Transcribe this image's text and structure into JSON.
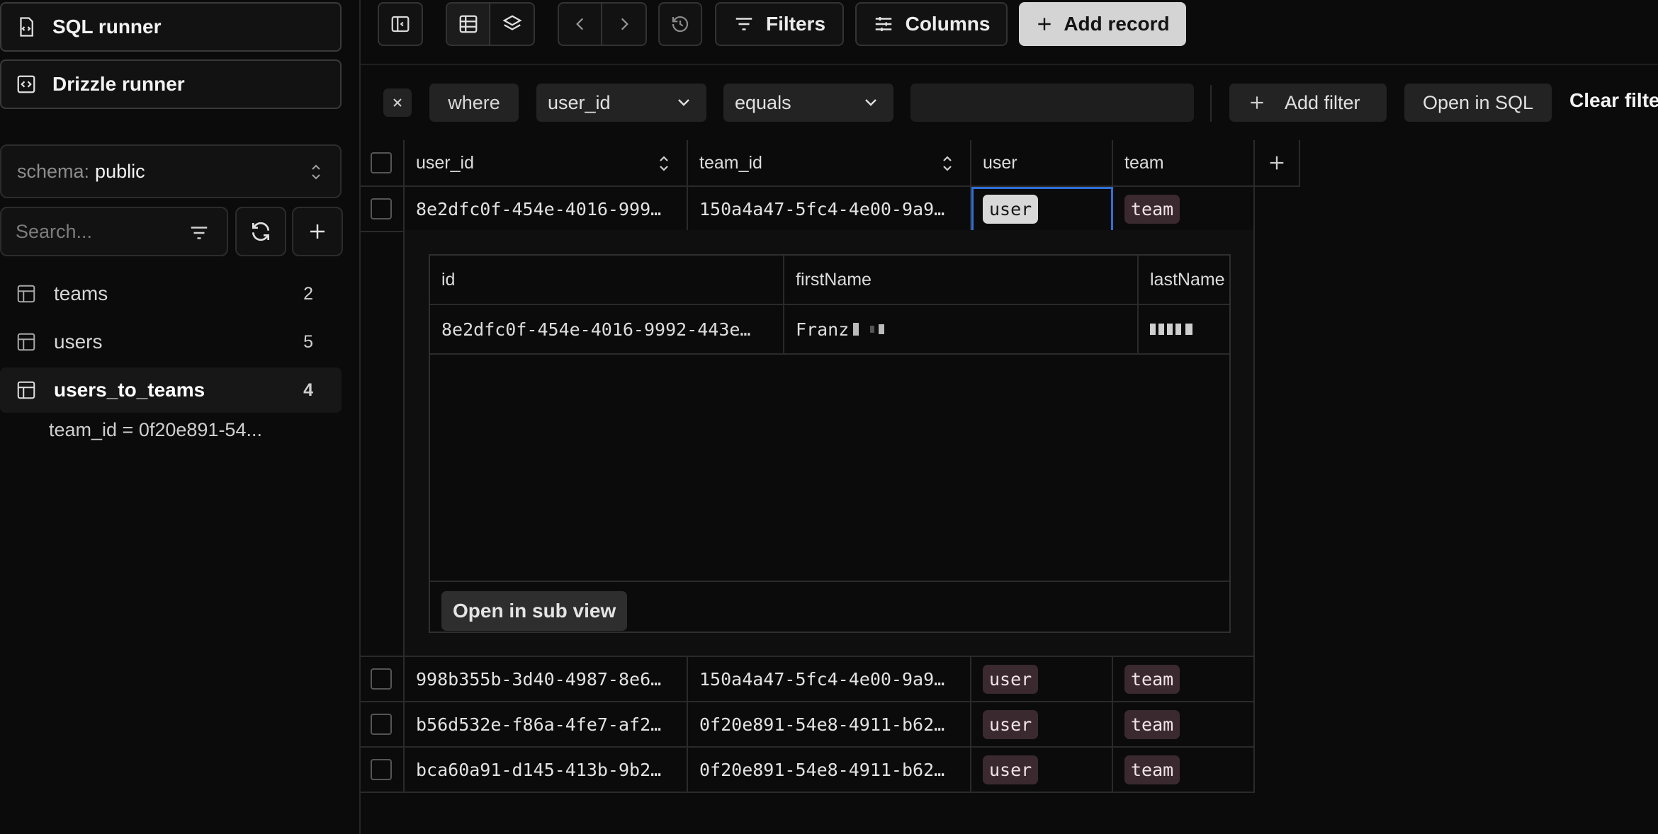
{
  "sidebar": {
    "sql_runner": "SQL runner",
    "drizzle_runner": "Drizzle runner",
    "schema_label": "schema:",
    "schema_value": "public",
    "search_placeholder": "Search...",
    "tables": [
      {
        "name": "teams",
        "count": "2",
        "active": false
      },
      {
        "name": "users",
        "count": "5",
        "active": false
      },
      {
        "name": "users_to_teams",
        "count": "4",
        "active": true
      }
    ],
    "active_filter": "team_id = 0f20e891-54..."
  },
  "toolbar": {
    "filters": "Filters",
    "columns": "Columns",
    "add_record": "Add record"
  },
  "filter_bar": {
    "where": "where",
    "column": "user_id",
    "operator": "equals",
    "value": "",
    "add_filter": "Add filter",
    "open_in_sql": "Open in SQL",
    "clear_filters": "Clear filte"
  },
  "grid": {
    "columns": [
      "user_id",
      "team_id",
      "user",
      "team"
    ],
    "rows": [
      {
        "user_id": "8e2dfc0f-454e-4016-999…",
        "team_id": "150a4a47-5fc4-4e00-9a9…",
        "user": "user",
        "team": "team"
      },
      {
        "user_id": "998b355b-3d40-4987-8e6…",
        "team_id": "150a4a47-5fc4-4e00-9a9…",
        "user": "user",
        "team": "team"
      },
      {
        "user_id": "b56d532e-f86a-4fe7-af2…",
        "team_id": "0f20e891-54e8-4911-b62…",
        "user": "user",
        "team": "team"
      },
      {
        "user_id": "bca60a91-d145-413b-9b2…",
        "team_id": "0f20e891-54e8-4911-b62…",
        "user": "user",
        "team": "team"
      }
    ]
  },
  "subview": {
    "columns": [
      "id",
      "firstName",
      "lastName"
    ],
    "row": {
      "id": "8e2dfc0f-454e-4016-9992-443e…",
      "firstName": "Franz",
      "lastName": ""
    },
    "open_button": "Open in sub view"
  }
}
